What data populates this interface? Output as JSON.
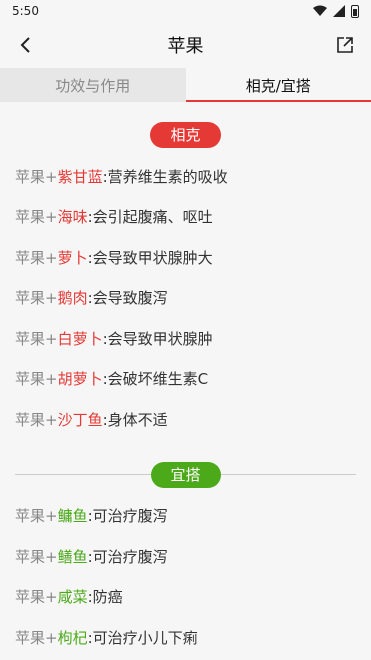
{
  "status": {
    "time": "5:50"
  },
  "header": {
    "title": "苹果"
  },
  "tabs": [
    {
      "label": "功效与作用",
      "active": false
    },
    {
      "label": "相克/宜搭",
      "active": true
    }
  ],
  "conflict": {
    "label": "相克",
    "color": "#e53935",
    "items": [
      {
        "base": "苹果+",
        "food": "紫甘蓝",
        "desc": ":营养维生素的吸收"
      },
      {
        "base": "苹果+",
        "food": "海味",
        "desc": ":会引起腹痛、呕吐"
      },
      {
        "base": "苹果+",
        "food": "萝卜",
        "desc": ":会导致甲状腺肿大"
      },
      {
        "base": "苹果+",
        "food": "鹅肉",
        "desc": ":会导致腹泻"
      },
      {
        "base": "苹果+",
        "food": "白萝卜",
        "desc": ":会导致甲状腺肿"
      },
      {
        "base": "苹果+",
        "food": "胡萝卜",
        "desc": ":会破坏维生素C"
      },
      {
        "base": "苹果+",
        "food": "沙丁鱼",
        "desc": ":身体不适"
      }
    ]
  },
  "suitable": {
    "label": "宜搭",
    "color": "#4caa1a",
    "items": [
      {
        "base": "苹果+",
        "food": "鳙鱼",
        "desc": ":可治疗腹泻"
      },
      {
        "base": "苹果+",
        "food": "鳝鱼",
        "desc": ":可治疗腹泻"
      },
      {
        "base": "苹果+",
        "food": "咸菜",
        "desc": ":防癌"
      },
      {
        "base": "苹果+",
        "food": "枸杞",
        "desc": ":可治疗小儿下痢"
      }
    ]
  }
}
